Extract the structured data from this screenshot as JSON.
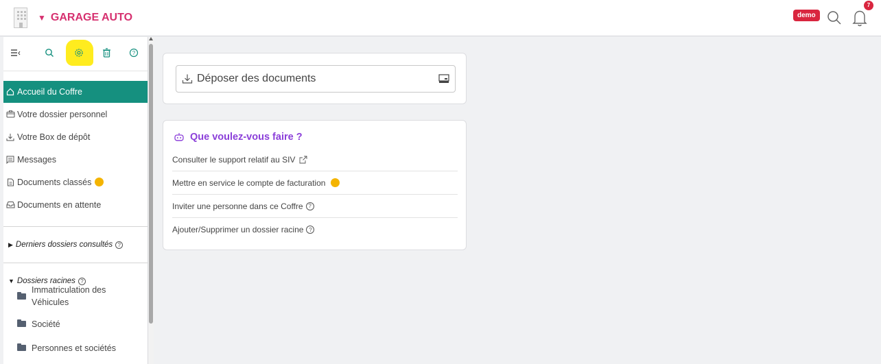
{
  "header": {
    "app_name": "GARAGE AUTO",
    "env_badge": "demo",
    "notification_count": "7"
  },
  "sidebar": {
    "toolbar": [
      "collapse-menu-icon",
      "search-icon",
      "gear-icon",
      "trash-icon",
      "help-icon"
    ],
    "items": [
      {
        "label": "Accueil du Coffre",
        "icon": "home-icon",
        "active": true
      },
      {
        "label": "Votre dossier personnel",
        "icon": "briefcase-icon"
      },
      {
        "label": "Votre Box de dépôt",
        "icon": "download-icon"
      },
      {
        "label": "Messages",
        "icon": "message-icon"
      },
      {
        "label": "Documents classés",
        "icon": "document-icon",
        "dot": true
      },
      {
        "label": "Documents en attente",
        "icon": "inbox-icon"
      }
    ],
    "recent_title": "Derniers dossiers consultés",
    "roots_title": "Dossiers racines",
    "root_folders": [
      "Immatriculation des",
      "Véhicules",
      "Société",
      "Personnes et sociétés"
    ]
  },
  "deposit": {
    "label": "Déposer des documents"
  },
  "actions": {
    "title": "Que voulez-vous faire ?",
    "items": [
      "Consulter le support relatif au SIV",
      "Mettre en service le compte de facturation",
      "Inviter une personne dans ce Coffre",
      "Ajouter/Supprimer un dossier racine"
    ]
  },
  "colors": {
    "brand": "#d6306f",
    "active_item": "#15907f",
    "accent_purple": "#8b3fd9",
    "badge_red": "#d9263f",
    "dot_yellow": "#f4b400"
  }
}
